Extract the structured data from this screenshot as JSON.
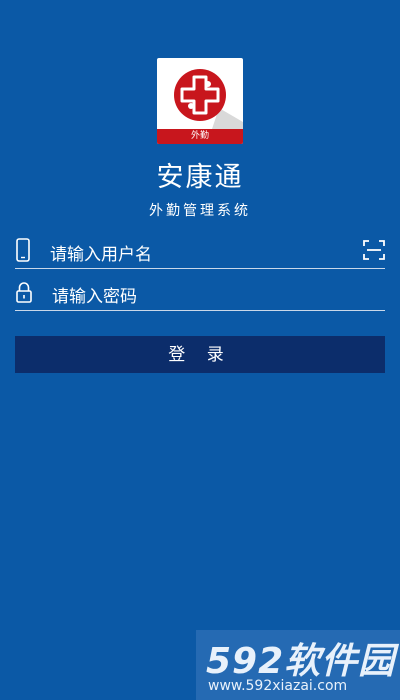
{
  "app": {
    "title": "安康通",
    "subtitle": "外勤管理系统",
    "logo_label": "外勤"
  },
  "username": {
    "placeholder": "请输入用户名",
    "icon": "smartphone-icon",
    "action_icon": "scan-icon"
  },
  "password": {
    "placeholder": "请输入密码",
    "icon": "lock-icon"
  },
  "login_button": {
    "label": "登 录"
  },
  "watermark": {
    "brand": "592软件园",
    "url": "www.592xiazai.com"
  },
  "colors": {
    "background": "#0b59a6",
    "button": "#0c2d6b",
    "logo_red": "#c8161d",
    "divider": "#c9d8ea"
  }
}
